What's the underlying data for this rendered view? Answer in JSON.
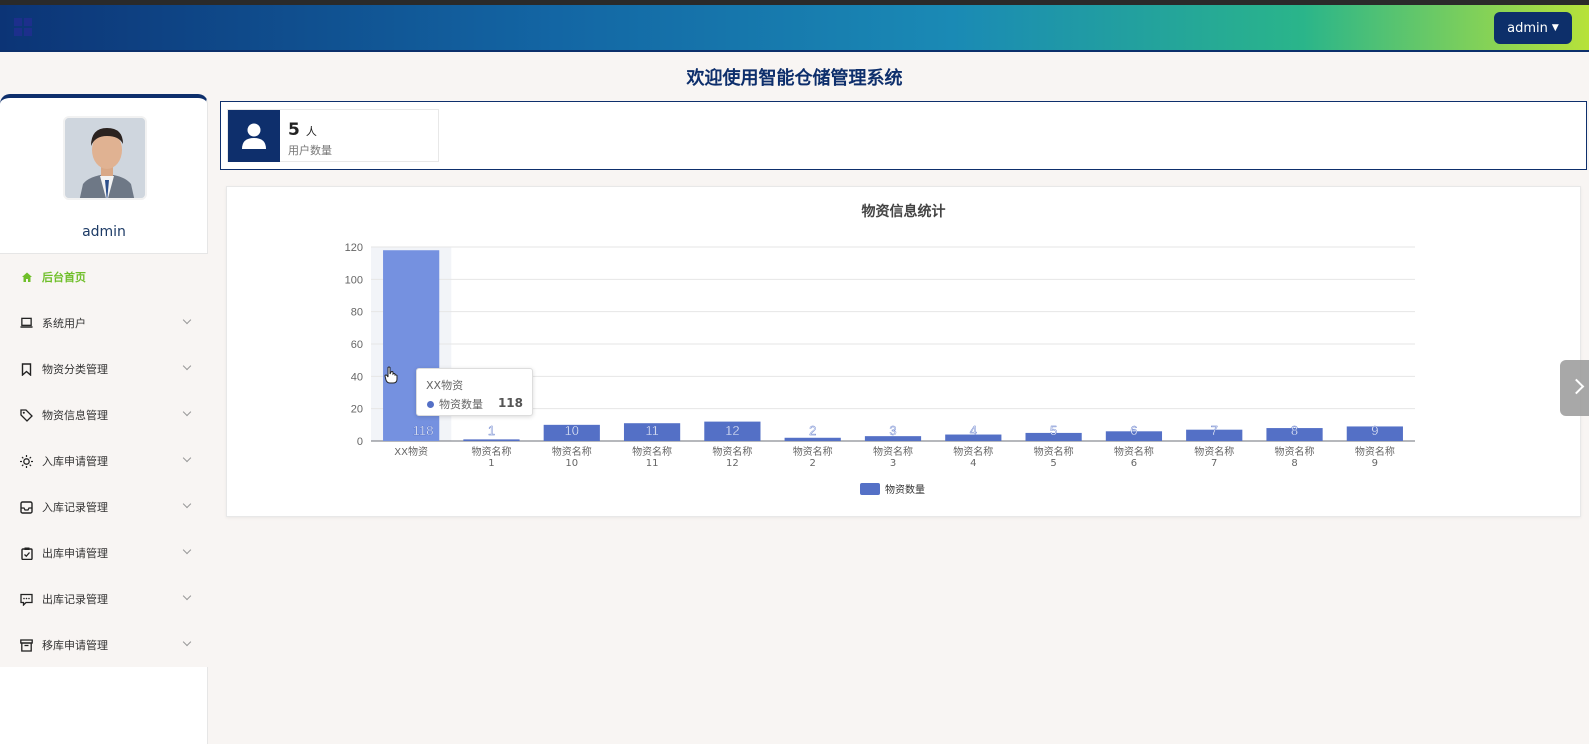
{
  "header": {
    "user_button": "admin"
  },
  "page": {
    "title": "欢迎使用智能仓储管理系统"
  },
  "sidebar": {
    "username": "admin",
    "items": [
      {
        "label": "后台首页",
        "icon": "home-icon",
        "active": true
      },
      {
        "label": "系统用户",
        "icon": "laptop-icon"
      },
      {
        "label": "物资分类管理",
        "icon": "bookmark-icon"
      },
      {
        "label": "物资信息管理",
        "icon": "tag-icon"
      },
      {
        "label": "入库申请管理",
        "icon": "sun-icon"
      },
      {
        "label": "入库记录管理",
        "icon": "inbox-icon"
      },
      {
        "label": "出库申请管理",
        "icon": "clipboard-icon"
      },
      {
        "label": "出库记录管理",
        "icon": "message-icon"
      },
      {
        "label": "移库申请管理",
        "icon": "archive-icon"
      }
    ]
  },
  "stats": {
    "value": "5",
    "unit": "人",
    "label": "用户数量"
  },
  "tooltip": {
    "title": "XX物资",
    "series": "物资数量",
    "value": "118"
  },
  "colors": {
    "brand": "#0e2f6c",
    "bar": "#5470c6",
    "active_menu": "#6fbf2a"
  },
  "chart_data": {
    "type": "bar",
    "title": "物资信息统计",
    "categories": [
      "XX物资",
      "物资名称\n1",
      "物资名称\n10",
      "物资名称\n11",
      "物资名称\n12",
      "物资名称\n2",
      "物资名称\n3",
      "物资名称\n4",
      "物资名称\n5",
      "物资名称\n6",
      "物资名称\n7",
      "物资名称\n8",
      "物资名称\n9"
    ],
    "series": [
      {
        "name": "物资数量",
        "values": [
          118,
          1,
          10,
          11,
          12,
          2,
          3,
          4,
          5,
          6,
          7,
          8,
          9
        ]
      }
    ],
    "ylim": [
      0,
      120
    ],
    "yticks": [
      0,
      20,
      40,
      60,
      80,
      100,
      120
    ],
    "grid": true,
    "legend": "bottom-center",
    "highlighted_category": "XX物资"
  }
}
